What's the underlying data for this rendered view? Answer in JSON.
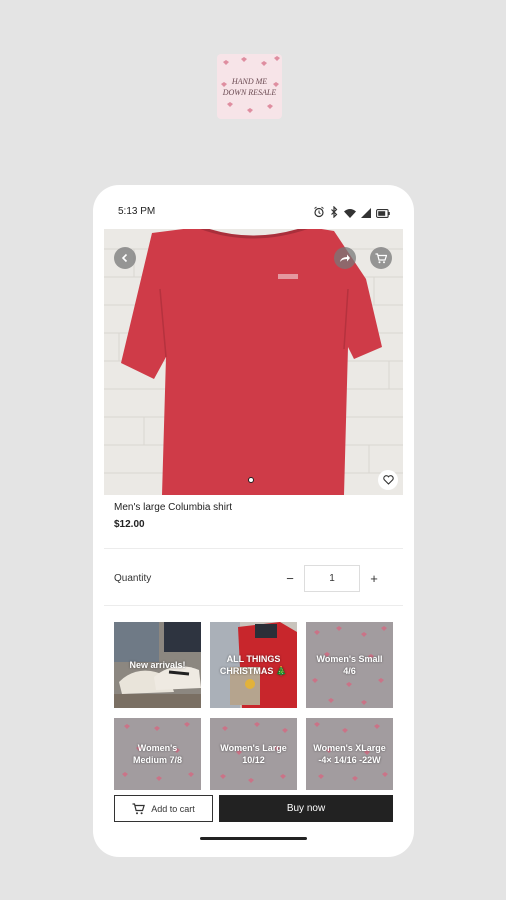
{
  "logo": {
    "text": "HAND ME DOWN RESALE"
  },
  "status_bar": {
    "time": "5:13 PM",
    "icons": [
      "alarm-icon",
      "bluetooth-icon",
      "wifi-icon",
      "signal-icon",
      "battery-icon"
    ]
  },
  "product": {
    "title": "Men's large Columbia shirt",
    "price": "$12.00",
    "image_index": 1,
    "image_count": 1,
    "colors": {
      "shirt": "#cf3b48",
      "wall": "#ebe9e5"
    }
  },
  "quantity": {
    "label": "Quantity",
    "value": "1",
    "minus": "−",
    "plus": "+"
  },
  "categories": [
    {
      "label": "New arrivals!",
      "style": "photo"
    },
    {
      "label": "ALL THINGS CHRISTMAS 🎄",
      "style": "photo"
    },
    {
      "label": "Women's Small 4/6",
      "style": "pattern"
    },
    {
      "label": "Women's Medium 7/8",
      "style": "pattern"
    },
    {
      "label": "Women's Large 10/12",
      "style": "pattern"
    },
    {
      "label": "Women's XLarge -4× 14/16 -22W",
      "style": "pattern"
    }
  ],
  "actions": {
    "add_to_cart": "Add to cart",
    "buy_now": "Buy now"
  },
  "colors": {
    "background": "#e4e4e4",
    "accent_dark": "#222222",
    "logo_bg": "#f7e4e8"
  }
}
